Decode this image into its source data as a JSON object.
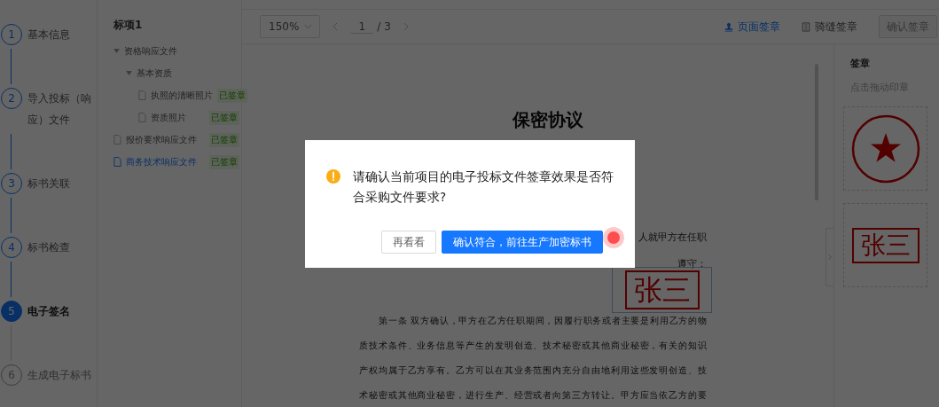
{
  "steps": [
    {
      "number": "1",
      "label": "基本信息",
      "completed": true,
      "selected": false
    },
    {
      "number": "2",
      "label": "导入投标（响应）文件",
      "completed": true,
      "selected": false
    },
    {
      "number": "3",
      "label": "标书关联",
      "completed": true,
      "selected": false
    },
    {
      "number": "4",
      "label": "标书检查",
      "completed": true,
      "selected": false
    },
    {
      "number": "5",
      "label": "电子签名",
      "completed": false,
      "selected": true
    },
    {
      "number": "6",
      "label": "生成电子标书",
      "completed": false,
      "selected": false
    }
  ],
  "tree": {
    "title": "标项1",
    "items": [
      {
        "label": "资格响应文件",
        "kind": "folder",
        "expanded": true,
        "selected": false,
        "children": [
          {
            "label": "基本资质",
            "kind": "folder",
            "expanded": true,
            "selected": false,
            "children": [
              {
                "label": "执照的清晰照片",
                "kind": "file",
                "badge": "已签章",
                "selected": false
              },
              {
                "label": "资质照片",
                "kind": "file",
                "badge": "已签章",
                "selected": false
              }
            ]
          }
        ]
      },
      {
        "label": "报价要求响应文件",
        "kind": "file",
        "badge": "已签章",
        "selected": false
      },
      {
        "label": "商务技术响应文件",
        "kind": "file",
        "badge": "已签章",
        "selected": true
      }
    ]
  },
  "toolbar": {
    "zoom": "150%",
    "page": "1",
    "page_total": "/ 3",
    "actions": [
      {
        "label": "页面签章",
        "kind": "page",
        "selected": true
      },
      {
        "label": "骑缝签章",
        "kind": "seam",
        "selected": false
      }
    ],
    "confirm_button": {
      "label": "确认签章",
      "disabled": true
    }
  },
  "document": {
    "title": "保密协议",
    "partial_lines": [
      "人就甲方在任职",
      "遵守："
    ],
    "stamp": "张三",
    "paragraph_lines": [
      "第一条  双方确认，甲方在乙方任职期间，因履行职务或者主要是利用乙方的物",
      "质技术条件、业务信息等产生的发明创造、技术秘密或其他商业秘密，有关的知识",
      "产权均属于乙方享有。乙方可以在其业务范围内充分自由地利用这些发明创造、技",
      "术秘密或其他商业秘密，进行生产、经营或者向第三方转让。甲方应当依乙方的要"
    ]
  },
  "seal_panel": {
    "title": "签章",
    "hint": "点击拖动印章",
    "stamps": [
      {
        "kind": "seal"
      },
      {
        "kind": "name",
        "text": "张三"
      }
    ]
  },
  "dialog": {
    "message": "请确认当前项目的电子投标文件签章效果是否符合采购文件要求?",
    "buttons": [
      {
        "label": "再看看",
        "kind": "default"
      },
      {
        "label": "确认符合，前往生产加密标书",
        "kind": "primary"
      }
    ]
  }
}
